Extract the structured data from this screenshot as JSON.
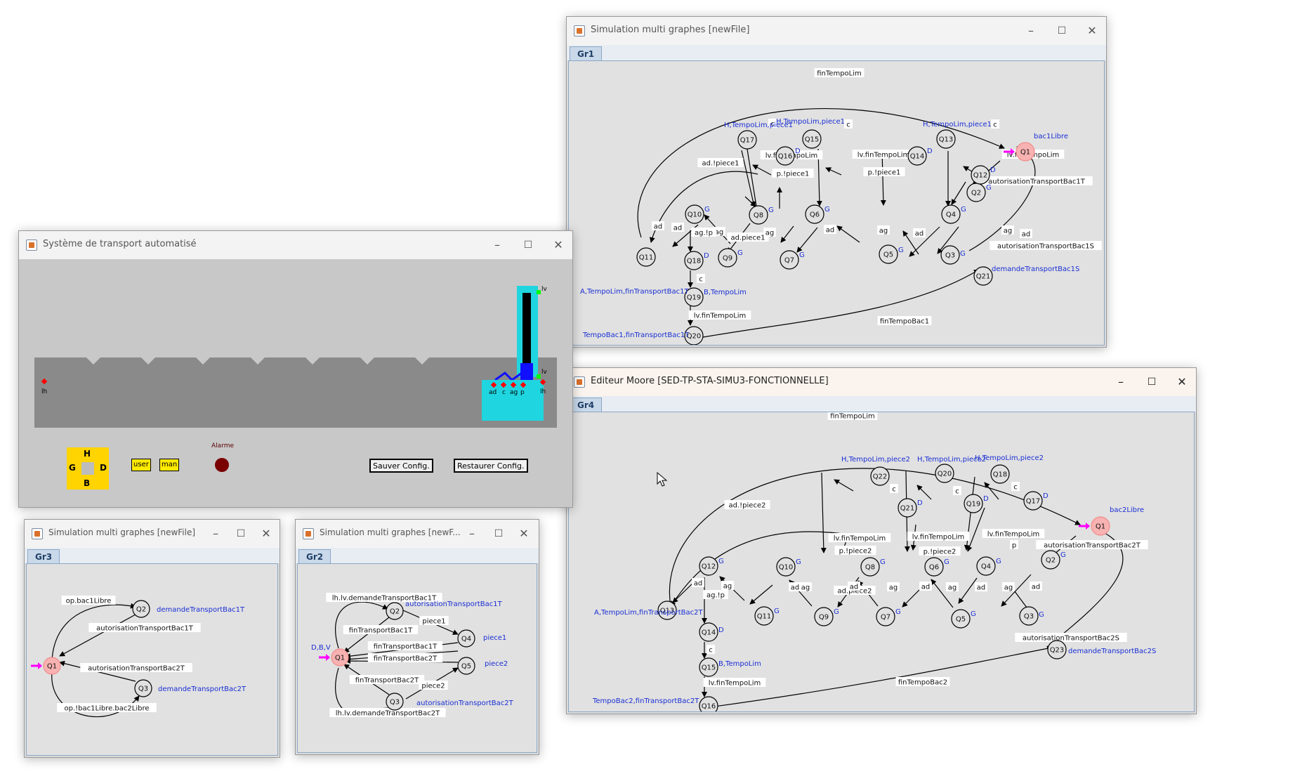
{
  "windows": {
    "sim_gr1": {
      "title": "Simulation multi graphes [newFile]",
      "tab": "Gr1"
    },
    "moore_gr4": {
      "title": "Editeur Moore [SED-TP-STA-SIMU3-FONCTIONNELLE]",
      "tab": "Gr4"
    },
    "transport": {
      "title": "Système de transport automatisé"
    },
    "sim_gr3": {
      "title": "Simulation multi graphes [newFile]",
      "tab": "Gr3"
    },
    "sim_gr2": {
      "title": "Simulation multi graphes [newF...",
      "tab": "Gr2"
    }
  },
  "controls": {
    "minimize": "–",
    "maximize": "☐",
    "close": "✕"
  },
  "transport": {
    "dpad": {
      "up": "H",
      "left": "G",
      "right": "D",
      "down": "B"
    },
    "user_button": "user",
    "man_button": "man",
    "alarm_label": "Alarme",
    "save_button": "Sauver Config.",
    "restore_button": "Restaurer Config.",
    "sensor_left": "lh",
    "lift_top": "lv",
    "lift_bottom": "lv",
    "sensors": [
      "ad",
      "c",
      "ag",
      "p"
    ],
    "sensor_right": "lh"
  },
  "colors": {
    "initial_state": "#f8b2b2",
    "initial_arrow": "#ff00ff",
    "output_text": "#1a2fd4",
    "yellow": "#ffd400",
    "cyan": "#1fd6e0",
    "alarm": "#7a0000"
  },
  "gr1": {
    "states": [
      "Q1",
      "Q2",
      "Q3",
      "Q4",
      "Q5",
      "Q6",
      "Q7",
      "Q8",
      "Q9",
      "Q10",
      "Q11",
      "Q12",
      "Q13",
      "Q14",
      "Q15",
      "Q16",
      "Q17",
      "Q18",
      "Q19",
      "Q20",
      "Q21"
    ],
    "outputs": {
      "Q1": "bac1Libre",
      "Q2": "G",
      "Q3": "G",
      "Q4": "G",
      "Q5": "G",
      "Q6": "G",
      "Q7": "G",
      "Q8": "G",
      "Q9": "G",
      "Q10": "G",
      "Q11": "A,TempoLim,finTransportBac1T",
      "Q12": "D",
      "Q13": "H,TempoLim,piece1",
      "Q14": "D",
      "Q15": "H,TempoLim,piece1",
      "Q16": "D",
      "Q17": "H,TempoLim,piece1",
      "Q18": "D",
      "Q19": "B,TempoLim",
      "Q20": "TempoBac1,finTransportBac1T",
      "Q21": "demandeTransportBac1S"
    },
    "edges": {
      "top": "finTempoLim",
      "q1_q2": "autorisationTransportBac1T",
      "q21_q1": "autorisationTransportBac1S",
      "q20_q21": "finTempoBac1",
      "adp": "ad.!piece1",
      "adp2": "ad.piece1",
      "lv1": "lv.finTempoLim",
      "lv2": "lv.finTempoLim",
      "lv3": "lv.finTempoLim",
      "pp1": "p.!piece1",
      "pp2": "p.!piece1",
      "p": "p",
      "c1": "c",
      "c2": "c",
      "c3": "c",
      "c4": "c",
      "ad1": "ad",
      "ad2": "ad",
      "ad3": "ad",
      "ad4": "ad",
      "ad5": "ad",
      "ag1": "ag",
      "ag2": "ag",
      "ag3": "ag",
      "ag4": "ag",
      "agp": "ag.!p",
      "lvq19": "lv.finTempoLim"
    }
  },
  "gr4": {
    "states": [
      "Q1",
      "Q2",
      "Q3",
      "Q4",
      "Q5",
      "Q6",
      "Q7",
      "Q8",
      "Q9",
      "Q10",
      "Q11",
      "Q12",
      "Q13",
      "Q14",
      "Q15",
      "Q16",
      "Q17",
      "Q18",
      "Q19",
      "Q20",
      "Q21",
      "Q22",
      "Q23"
    ],
    "outputs": {
      "Q1": "bac2Libre",
      "Q2": "G",
      "Q3": "G",
      "Q4": "G",
      "Q5": "G",
      "Q6": "G",
      "Q7": "G",
      "Q8": "G",
      "Q9": "G",
      "Q10": "G",
      "Q11": "G",
      "Q12": "G",
      "Q13": "A,TempoLim,finTransportBac2T",
      "Q14": "D",
      "Q15": "B,TempoLim",
      "Q16": "TempoBac2,finTransportBac2T",
      "Q17": "D",
      "Q18": "H,TempoLim,piece2",
      "Q19": "D",
      "Q20": "H,TempoLim,piece2",
      "Q21": "D",
      "Q22": "H,TempoLim,piece2",
      "Q23": "demandeTransportBac2S"
    },
    "edges": {
      "top": "finTempoLim",
      "q1_q2": "autorisationTransportBac2T",
      "q23_q1": "autorisationTransportBac2S",
      "q16_q23": "finTempoBac2",
      "adp": "ad.!piece2",
      "adp2": "ad.piece2",
      "lv1": "lv.finTempoLim",
      "lv2": "lv.finTempoLim",
      "lv3": "lv.finTempoLim",
      "pp1": "p.!piece2",
      "pp2": "p.!piece2",
      "p": "p",
      "c1": "c",
      "c2": "c",
      "c3": "c",
      "c4": "c",
      "ad1": "ad",
      "ad2": "ad",
      "ad3": "ad",
      "ad4": "ad",
      "ad5": "ad",
      "ad6": "ad",
      "ag1": "ag",
      "ag2": "ag",
      "ag3": "ag",
      "ag4": "ag",
      "ag5": "ag",
      "agp": "ag.!p",
      "lvq15": "lv.finTempoLim"
    }
  },
  "gr3": {
    "states": [
      "Q1",
      "Q2",
      "Q3"
    ],
    "outputs": {
      "Q2": "demandeTransportBac1T",
      "Q3": "demandeTransportBac2T"
    },
    "edges": {
      "q1_q2": "op.bac1Libre",
      "q2_q1": "autorisationTransportBac1T",
      "q3_q1": "autorisationTransportBac2T",
      "q1_q3": "op.!bac1Libre.bac2Libre"
    }
  },
  "gr2": {
    "states": [
      "Q1",
      "Q2",
      "Q3",
      "Q4",
      "Q5"
    ],
    "outputs": {
      "Q1": "D,B,V",
      "Q2": "autorisationTransportBac1T",
      "Q3": "autorisationTransportBac2T",
      "Q4": "piece1",
      "Q5": "piece2"
    },
    "edges": {
      "top": "lh.lv.demandeTransportBac1T",
      "bottom": "lh.lv.demandeTransportBac2T",
      "q2_q1": "finTransportBac1T",
      "q4_q1a": "finTransportBac1T",
      "q5_q1": "finTransportBac2T",
      "q3_q1": "finTransportBac2T",
      "q2_q4": "piece1",
      "q3_q5": "piece2"
    }
  }
}
